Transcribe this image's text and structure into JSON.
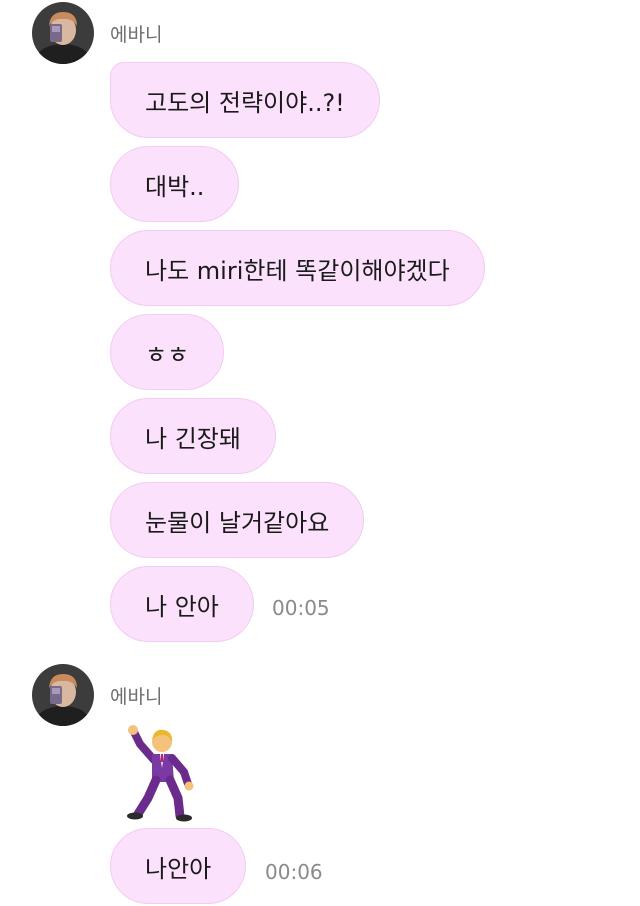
{
  "groups": [
    {
      "sender_name": "에바니",
      "messages": [
        "고도의 전략이야..?!",
        "대박..",
        "나도 miri한테 똑같이해야겠다",
        "ㅎㅎ",
        "나 긴장돼",
        "눈물이 날거같아요",
        "나 안아"
      ],
      "timestamp": "00:05"
    },
    {
      "sender_name": "에바니",
      "sticker": "man-dancing-emoji",
      "messages": [
        "나안아"
      ],
      "timestamp": "00:06"
    }
  ],
  "colors": {
    "bubble_background": "#fbe1fb",
    "bubble_border": "#f1ccf1",
    "timestamp_text": "#8a8a8a",
    "sender_text": "#6f6f6f"
  }
}
